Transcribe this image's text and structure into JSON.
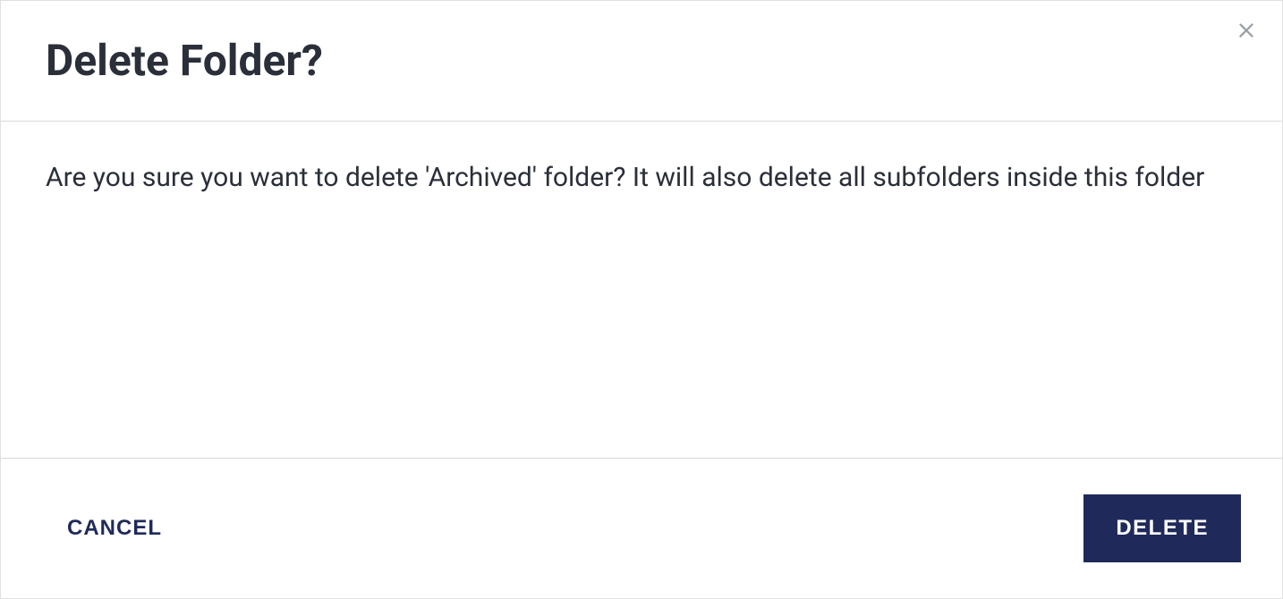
{
  "dialog": {
    "title": "Delete Folder?",
    "message": "Are you sure you want to delete 'Archived' folder? It will also delete all subfolders inside this folder",
    "cancel_label": "CANCEL",
    "delete_label": "DELETE"
  }
}
